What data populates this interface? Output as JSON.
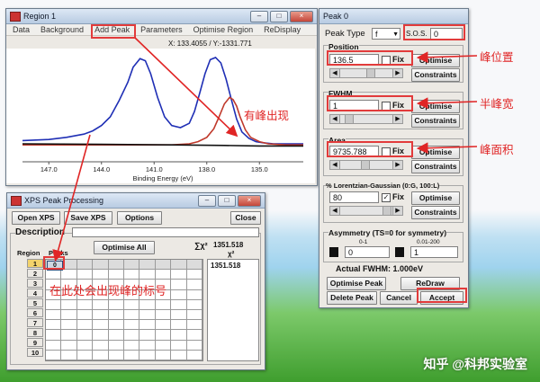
{
  "region_window": {
    "title": "Region 1",
    "menu": [
      "Data",
      "Background",
      "Add Peak",
      "Parameters",
      "Optimise Region",
      "ReDisplay"
    ],
    "coord_readout": "X: 133.4055 / Y:-1331.771",
    "xlabel": "Binding Energy (eV)",
    "x_ticks": [
      "147.0",
      "144.0",
      "141.0",
      "138.0",
      "135.0"
    ]
  },
  "chart_data": {
    "type": "line",
    "xlabel": "Binding Energy (eV)",
    "x_reversed": true,
    "xlim": [
      148.5,
      132.5
    ],
    "ylim": [
      0,
      100
    ],
    "series": [
      {
        "color": "#1f2fb5",
        "x": [
          148.5,
          147,
          146,
          145,
          144.5,
          144,
          143.5,
          143,
          142.5,
          142.2,
          141.8,
          141.5,
          141.2,
          140.8,
          140.4,
          140,
          139.5,
          139,
          138.7,
          138.4,
          138.1,
          137.8,
          137.5,
          137.2,
          136.9,
          136.6,
          136.3,
          136,
          135.6,
          135.2,
          134.8,
          134.2,
          133.5,
          132.5
        ],
        "y": [
          18,
          19,
          21,
          24,
          27,
          32,
          40,
          55,
          72,
          86,
          94,
          92,
          80,
          58,
          40,
          32,
          30,
          34,
          45,
          62,
          80,
          93,
          95,
          90,
          75,
          56,
          38,
          26,
          20,
          17,
          16,
          15,
          15,
          15
        ]
      },
      {
        "color": "#c0392b",
        "x": [
          148.5,
          146,
          144,
          142,
          140,
          139,
          138.5,
          138,
          137.6,
          137.3,
          137,
          136.7,
          136.5,
          136.3,
          136.1,
          135.8,
          135.5,
          135,
          134.5,
          133.5,
          132.5
        ],
        "y": [
          14,
          14,
          14,
          14,
          14,
          15,
          17,
          21,
          29,
          40,
          52,
          58,
          56,
          50,
          40,
          28,
          21,
          17,
          15,
          14,
          14
        ]
      },
      {
        "color": "#111111",
        "x": [
          148.5,
          144,
          140,
          137,
          135,
          132.5
        ],
        "y": [
          15,
          14.5,
          14,
          13.5,
          13,
          13
        ]
      }
    ]
  },
  "xps_window": {
    "title": "XPS Peak Processing",
    "buttons": {
      "open": "Open XPS",
      "save": "Save XPS",
      "options": "Options",
      "close": "Close"
    },
    "description_label": "Description",
    "region_header": "Region",
    "peaks_header": "Peaks",
    "optimise_all": "Optimise All",
    "sum_chi_label": "∑χ²",
    "sum_chi_value": "1351.518",
    "chi_label": "χ²",
    "chi_value": "1351.518",
    "peak_cell_value": "0",
    "rows": [
      "1",
      "2",
      "3",
      "4",
      "5",
      "6",
      "7",
      "8",
      "9",
      "10"
    ]
  },
  "peak_window": {
    "title": "Peak 0",
    "peak_type_label": "Peak Type",
    "peak_type_value": "f",
    "sos_label": "S.O.S.",
    "sos_value": "0",
    "position_label": "Position",
    "position_value": "136.5",
    "fwhm_label": "FWHM",
    "fwhm_value": "1",
    "area_label": "Area",
    "area_value": "9735.788",
    "lg_label": "% Lorentzian-Gaussian (0:G, 100:L)",
    "lg_value": "80",
    "fix_label": "Fix",
    "optimise_label": "Optimise",
    "constraints_label": "Constraints",
    "asym_label": "Asymmetry (TS=0 for symmetry)",
    "asym_range_left": "0-1",
    "asym_range_right": "0.01-200",
    "asym_value_left": "0",
    "asym_value_right": "1",
    "actual_fwhm": "Actual FWHM:  1.000eV",
    "optimise_peak": "Optimise Peak",
    "redraw": "ReDraw",
    "delete_peak": "Delete Peak",
    "cancel": "Cancel",
    "accept": "Accept"
  },
  "annotations": {
    "position": "峰位置",
    "fwhm": "半峰宽",
    "area": "峰面积",
    "has_peak": "有峰出现",
    "peak_here": "在此处会出现峰的标号"
  },
  "watermark": "知乎 @科邦实验室",
  "colors": {
    "annotation_red": "#e02525",
    "blue_curve": "#1f2fb5",
    "red_curve": "#c0392b"
  }
}
